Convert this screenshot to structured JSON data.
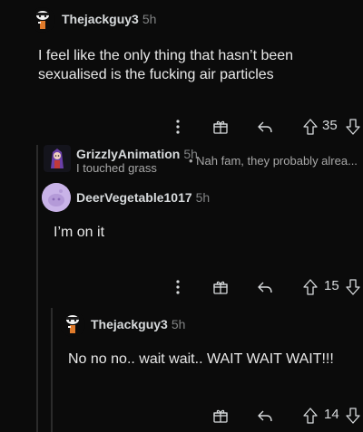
{
  "comments": [
    {
      "username": "Thejackguy3",
      "time": "5h",
      "text": "I feel like the only thing that hasn’t been sexualised is the fucking air particles",
      "votes": "35"
    },
    {
      "username": "GrizzlyAnimation",
      "time": "5h",
      "flair": "I touched grass",
      "preview": "• Nah fam, they probably alrea..."
    },
    {
      "username": "DeerVegetable1017",
      "time": "5h",
      "text": "I’m on it",
      "votes": "15"
    },
    {
      "username": "Thejackguy3",
      "time": "5h",
      "text": "No no no.. wait wait.. WAIT WAIT WAIT!!!",
      "votes": "14"
    }
  ],
  "icons": {
    "more": "more-vertical-icon",
    "award": "award-icon",
    "reply": "reply-icon",
    "upvote": "upvote-icon",
    "downvote": "downvote-icon"
  },
  "colors": {
    "background": "#0b0b0b",
    "text": "#d7dadc",
    "muted": "#818384",
    "deer_avatar": "#c9b3e8"
  }
}
